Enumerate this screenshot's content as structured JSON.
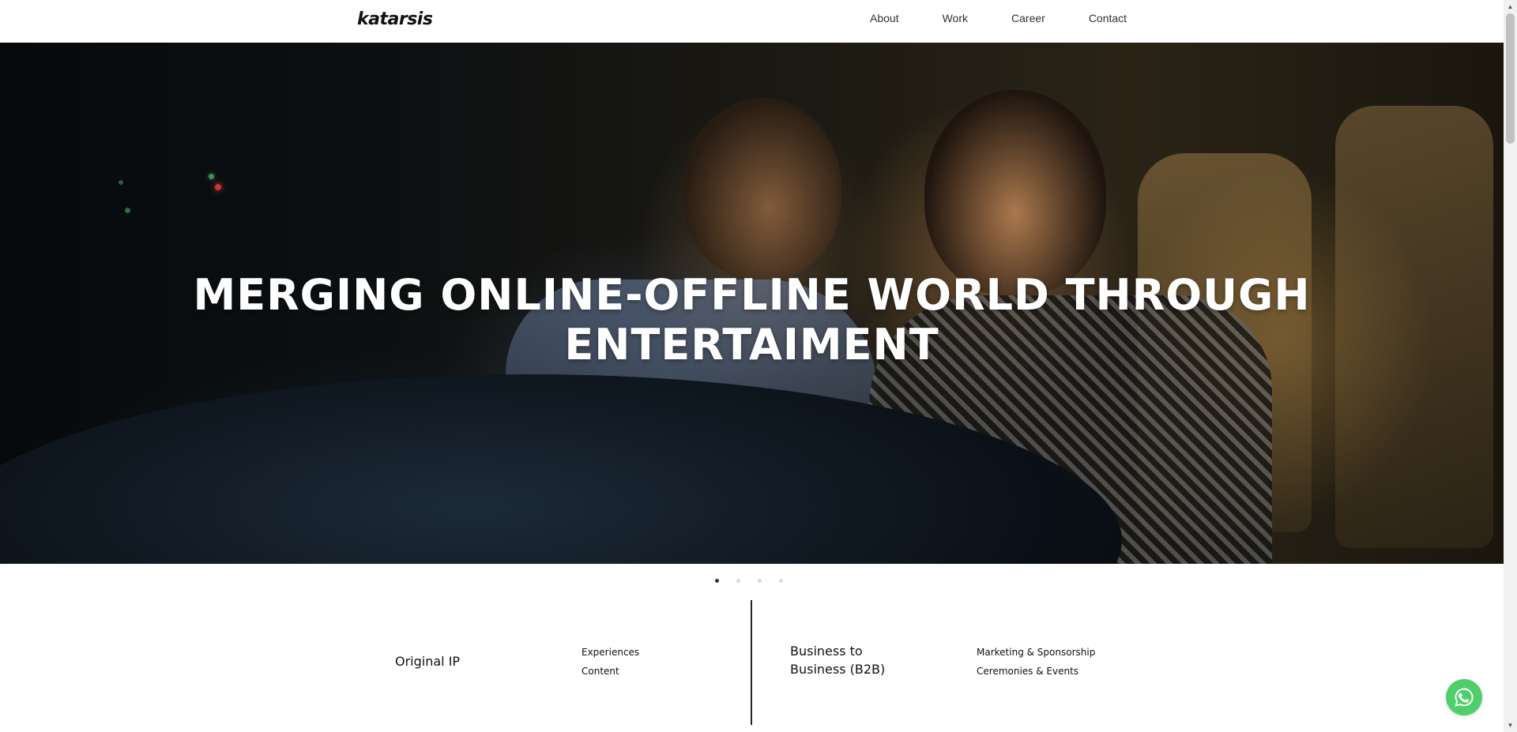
{
  "header": {
    "logo": "katarsis",
    "nav": [
      "About",
      "Work",
      "Career",
      "Contact"
    ]
  },
  "hero": {
    "title": "MERGING ONLINE-OFFLINE WORLD THROUGH ENTERTAIMENT",
    "slide_count": 4,
    "active_slide": 1
  },
  "services": {
    "original_ip": {
      "title": "Original IP",
      "items": [
        "Experiences",
        "Content"
      ]
    },
    "b2b": {
      "title_line1": "Business to",
      "title_line2": "Business (B2B)",
      "items": [
        "Marketing & Sponsorship",
        "Ceremonies & Events"
      ]
    }
  },
  "whatsapp": {
    "icon": "whatsapp-icon",
    "color": "#4fce6b"
  },
  "scrollbar": {
    "up_arrow": "▲",
    "down_arrow": "▼"
  }
}
